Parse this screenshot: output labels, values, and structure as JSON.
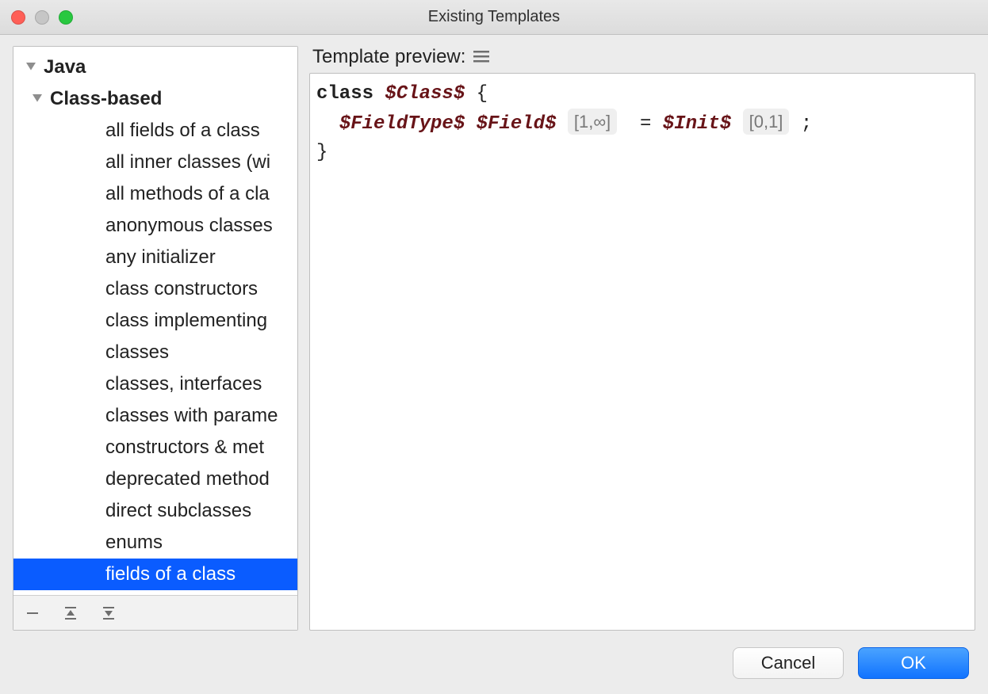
{
  "window": {
    "title": "Existing Templates"
  },
  "tree": {
    "root_label": "Java",
    "group_label": "Class-based",
    "items": [
      "all fields of a class",
      "all inner classes (wi",
      "all methods of a cla",
      "anonymous classes",
      "any initializer",
      "class constructors",
      "class implementing",
      "classes",
      "classes, interfaces ",
      "classes with parame",
      "constructors & met",
      "deprecated method",
      "direct subclasses",
      "enums",
      "fields of a class"
    ],
    "selected_index": 14
  },
  "preview": {
    "header": "Template preview:",
    "code": {
      "kw_class": "class",
      "var_class": "$Class$",
      "brace_open": "{",
      "indent": "  ",
      "var_fieldtype": "$FieldType$",
      "var_field": "$Field$",
      "chip_field": "[1,∞]",
      "eq": " = ",
      "var_init": "$Init$",
      "chip_init": "[0,1]",
      "semi": ";",
      "brace_close": "}"
    }
  },
  "buttons": {
    "cancel": "Cancel",
    "ok": "OK"
  },
  "icons": {
    "remove": "remove",
    "expand_all": "expand-all",
    "collapse_all": "collapse-all",
    "menu": "menu"
  }
}
